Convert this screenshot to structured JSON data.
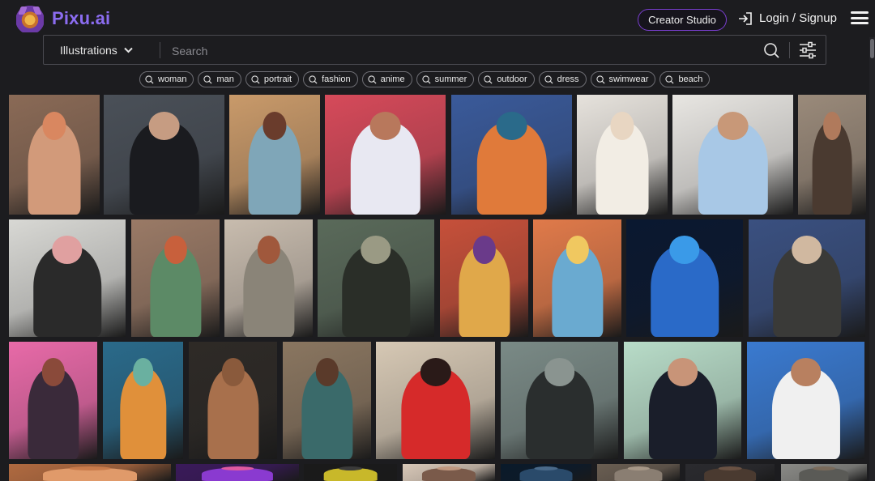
{
  "header": {
    "brand": "Pixu.ai",
    "creator_button": "Creator Studio",
    "login_label": "Login / Signup"
  },
  "search": {
    "category": "Illustrations",
    "placeholder": "Search"
  },
  "tags": [
    "woman",
    "man",
    "portrait",
    "fashion",
    "anime",
    "summer",
    "outdoor",
    "dress",
    "swimwear",
    "beach"
  ],
  "gallery": {
    "row1": [
      {
        "bg": "#8a6a56",
        "fig": "#d29a7a",
        "head": "#d98760"
      },
      {
        "bg": "#4a5058",
        "fig": "#1a1b1f",
        "head": "#c69c82"
      },
      {
        "bg": "#c99a6a",
        "fig": "#7fa6b8",
        "head": "#6a3c2c"
      },
      {
        "bg": "#d64a5a",
        "fig": "#e8e8f2",
        "head": "#b8785c"
      },
      {
        "bg": "#3a5a9a",
        "fig": "#e07a3a",
        "head": "#2a6a8a"
      },
      {
        "bg": "#e6e2dc",
        "fig": "#f2ede4",
        "head": "#e8d6c2"
      },
      {
        "bg": "#e8e6e2",
        "fig": "#a8c8e6",
        "head": "#c89878"
      },
      {
        "bg": "#9a8a7a",
        "fig": "#4a3a30",
        "head": "#b07a5c"
      }
    ],
    "row2": [
      {
        "bg": "#d8d8d4",
        "fig": "#2a2a2a",
        "head": "#e0a0a0"
      },
      {
        "bg": "#9a7a66",
        "fig": "#5c8a66",
        "head": "#c8603c"
      },
      {
        "bg": "#c8bcae",
        "fig": "#8a8478",
        "head": "#a0583c"
      },
      {
        "bg": "#5a6a5a",
        "fig": "#2a2e28",
        "head": "#9a9a84"
      },
      {
        "bg": "#c6503a",
        "fig": "#e0a84a",
        "head": "#6a3a8a"
      },
      {
        "bg": "#e07a4a",
        "fig": "#6aaad0",
        "head": "#f0c860"
      },
      {
        "bg": "#0a1830",
        "fig": "#2a6ac8",
        "head": "#3a9ae8"
      },
      {
        "bg": "#3a5080",
        "fig": "#3a3a38",
        "head": "#d0b8a0"
      }
    ],
    "row3": [
      {
        "bg": "#e86aa8",
        "fig": "#3a2a3a",
        "head": "#8a4a3a"
      },
      {
        "bg": "#2a6a8a",
        "fig": "#e0903a",
        "head": "#6ab0a0"
      },
      {
        "bg": "#2e2a26",
        "fig": "#a8704c",
        "head": "#8a5a3c"
      },
      {
        "bg": "#8a7660",
        "fig": "#3a6a6a",
        "head": "#5a3a2a"
      },
      {
        "bg": "#d6c8b4",
        "fig": "#d62a2a",
        "head": "#2a1a18"
      },
      {
        "bg": "#7a8a86",
        "fig": "#2a2e2e",
        "head": "#8a9490"
      },
      {
        "bg": "#b8dcc8",
        "fig": "#1a1e2a",
        "head": "#c89478"
      },
      {
        "bg": "#3a7ad0",
        "fig": "#f0f0f0",
        "head": "#b88060"
      }
    ],
    "row4": [
      {
        "bg": "#b06a40",
        "fig": "#e09a6a",
        "head": "#c87a4a"
      },
      {
        "bg": "#3a1a5a",
        "fig": "#8a3ad0",
        "head": "#e05aa0"
      },
      {
        "bg": "#1a1a1a",
        "fig": "#c8b82a",
        "head": "#3a3a3a"
      },
      {
        "bg": "#d8c8b8",
        "fig": "#7a5a4a",
        "head": "#c09880"
      },
      {
        "bg": "#0a1a2a",
        "fig": "#2a4a6a",
        "head": "#4a6a8a"
      },
      {
        "bg": "#6a5e52",
        "fig": "#8a7e72",
        "head": "#a89888"
      },
      {
        "bg": "#2a2a2e",
        "fig": "#4a3a30",
        "head": "#6a5244"
      },
      {
        "bg": "#8a8a86",
        "fig": "#5a5a56",
        "head": "#7a6a5a"
      }
    ]
  }
}
